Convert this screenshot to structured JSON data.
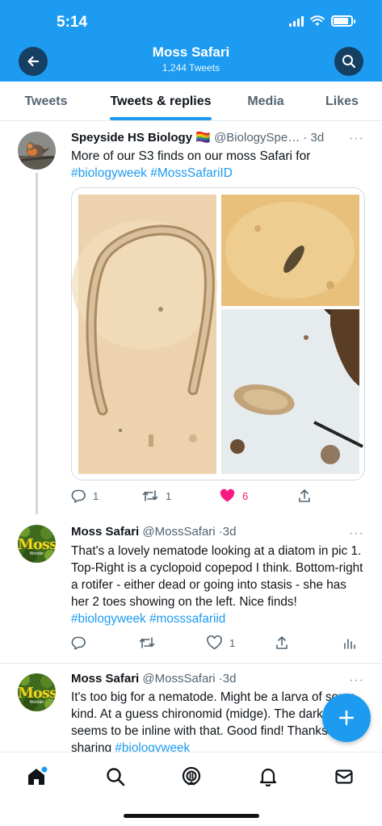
{
  "status_bar": {
    "time": "5:14",
    "battery_level": 0.85
  },
  "header": {
    "title": "Moss Safari",
    "subtitle": "1,244 Tweets",
    "back_icon": "arrow-left-icon",
    "search_icon": "search-icon",
    "color": "#1d9bf0"
  },
  "tabs": [
    {
      "label": "Tweets",
      "active": false
    },
    {
      "label": "Tweets & replies",
      "active": true
    },
    {
      "label": "Media",
      "active": false
    },
    {
      "label": "Likes",
      "active": false
    }
  ],
  "tweets": [
    {
      "name": "Speyside HS Biology",
      "flag": "🏳️‍🌈",
      "handle": "@BiologySpe…",
      "time": "3d",
      "more": "···",
      "text_1": "More of our S3 finds on our moss Safari for",
      "hashtag_1": "#biologyweek",
      "hashtag_2": "#MossSafariID",
      "replies": "1",
      "retweets": "1",
      "likes": "6",
      "liked": true
    },
    {
      "name": "Moss Safari",
      "handle": "@MossSafari",
      "time": "3d",
      "more": "···",
      "text_1": "That's a lovely nematode looking at a diatom in pic 1. Top-Right is a cyclopoid copepod I think. Bottom-right a rotifer - either dead or going into stasis - she has her 2 toes showing on the left. Nice finds!",
      "hashtag_1": "#biologyweek",
      "hashtag_2": "#mosssafariid",
      "replies": "",
      "retweets": "",
      "likes": "1",
      "avatar_text": "Moss",
      "avatar_sub": "Wonder"
    },
    {
      "name": "Moss Safari",
      "handle": "@MossSafari",
      "time": "3d",
      "more": "···",
      "text_1": "It's too big for a nematode. Might be a larva of some kind. At a guess chironomid (midge). The dark head seems to be inline with that. Good find! Thanks for sharing",
      "hashtag_1": "#biologyweek",
      "avatar_text": "Moss",
      "avatar_sub": "Wonder"
    }
  ],
  "fab": {
    "label": "+",
    "icon": "compose-plus-icon"
  },
  "bottom_nav": [
    {
      "icon": "home-icon",
      "active": true
    },
    {
      "icon": "search-icon"
    },
    {
      "icon": "spaces-icon"
    },
    {
      "icon": "notifications-bell-icon"
    },
    {
      "icon": "messages-envelope-icon"
    }
  ],
  "colors": {
    "accent": "#1d9bf0",
    "like": "#f91880",
    "muted": "#536471"
  }
}
